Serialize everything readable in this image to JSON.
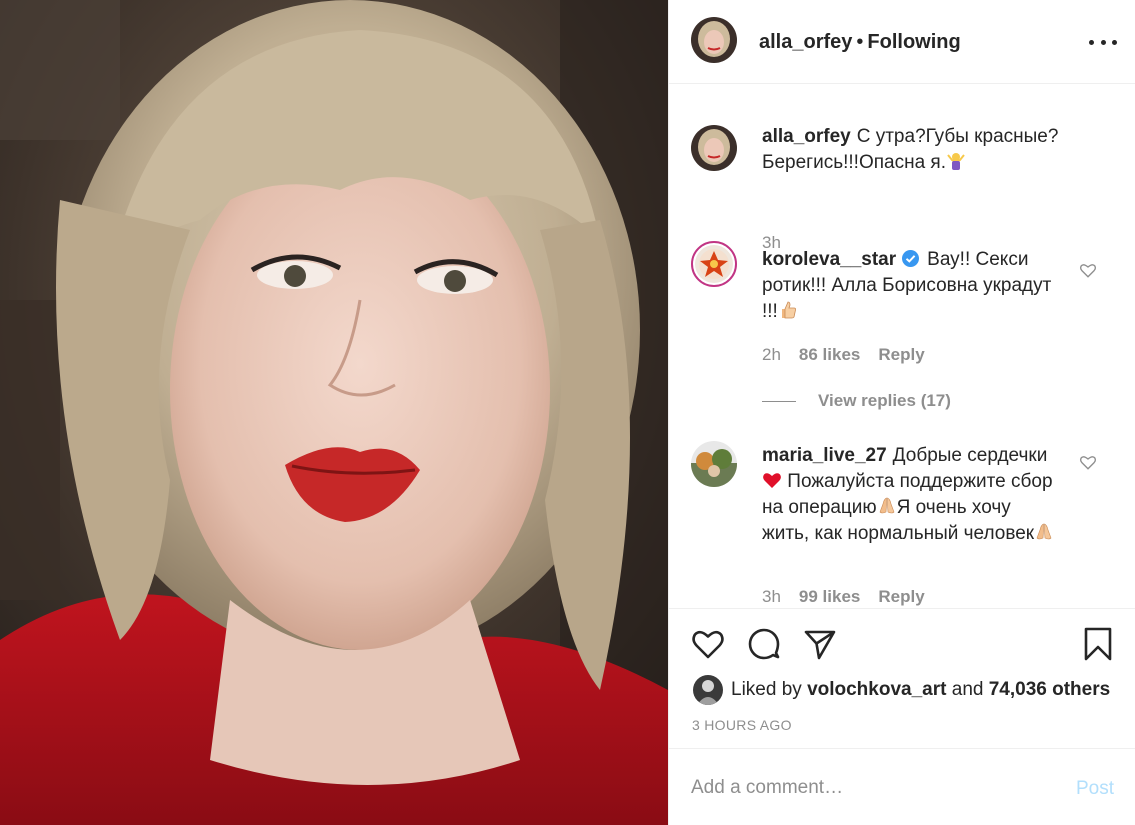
{
  "post": {
    "author": "alla_orfey",
    "separator": "•",
    "follow_status": "Following"
  },
  "caption": {
    "author": "alla_orfey",
    "text": "С утра?Губы красные? Берегись!!!Опасна я.",
    "emoji": "person-shrugging-emoji",
    "time": "3h"
  },
  "comments": [
    {
      "author": "koroleva__star",
      "verified": true,
      "text": "Вау!! Секси ротик!!! Алла Борисовна украдут !!!",
      "emoji": "thumbs-up-emoji",
      "time": "2h",
      "likes": "86 likes",
      "reply": "Reply",
      "view_replies": "View replies (17)"
    },
    {
      "author": "maria_live_27",
      "verified": false,
      "text_parts": [
        "Добрые сердечки",
        "Пожалуйста поддержите сбор на операцию",
        "Я очень хочу жить, как нормальный человек"
      ],
      "emojis": [
        "red-heart-emoji",
        "folded-hands-emoji",
        "folded-hands-emoji"
      ],
      "time": "3h",
      "likes": "99 likes",
      "reply": "Reply"
    }
  ],
  "actions": {
    "like_icon": "heart-outline-icon",
    "comment_icon": "speech-bubble-icon",
    "share_icon": "paper-plane-icon",
    "save_icon": "bookmark-icon"
  },
  "likes": {
    "prefix": "Liked by",
    "user": "volochkova_art",
    "conjunction": "and",
    "others": "74,036 others"
  },
  "timestamp": "3 HOURS AGO",
  "add_comment": {
    "placeholder": "Add a comment…",
    "post_label": "Post"
  },
  "colors": {
    "text": "#262626",
    "secondary": "#8e8e8e",
    "post_disabled": "#b2dffc",
    "verified": "#3897f0",
    "story_ring": "#c13584",
    "lips": "#c62828",
    "sweater": "#b0121c"
  }
}
